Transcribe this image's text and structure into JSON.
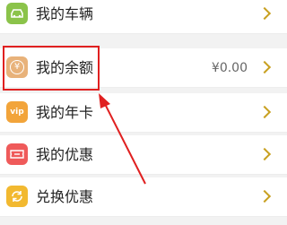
{
  "menu": {
    "items": [
      {
        "label": "我的车辆",
        "icon": "car-icon",
        "color": "#8bc34a"
      },
      {
        "label": "我的余额",
        "icon": "yuan-coin-icon",
        "color": "#e8b27a",
        "value": "¥0.00"
      },
      {
        "label": "我的年卡",
        "icon": "vip-icon",
        "color": "#f2a43a",
        "badge": "vip"
      },
      {
        "label": "我的优惠",
        "icon": "ticket-icon",
        "color": "#ef5a5a"
      },
      {
        "label": "兑换优惠",
        "icon": "exchange-icon",
        "color": "#f2b930"
      }
    ]
  },
  "annotation": {
    "color": "#e02020"
  }
}
